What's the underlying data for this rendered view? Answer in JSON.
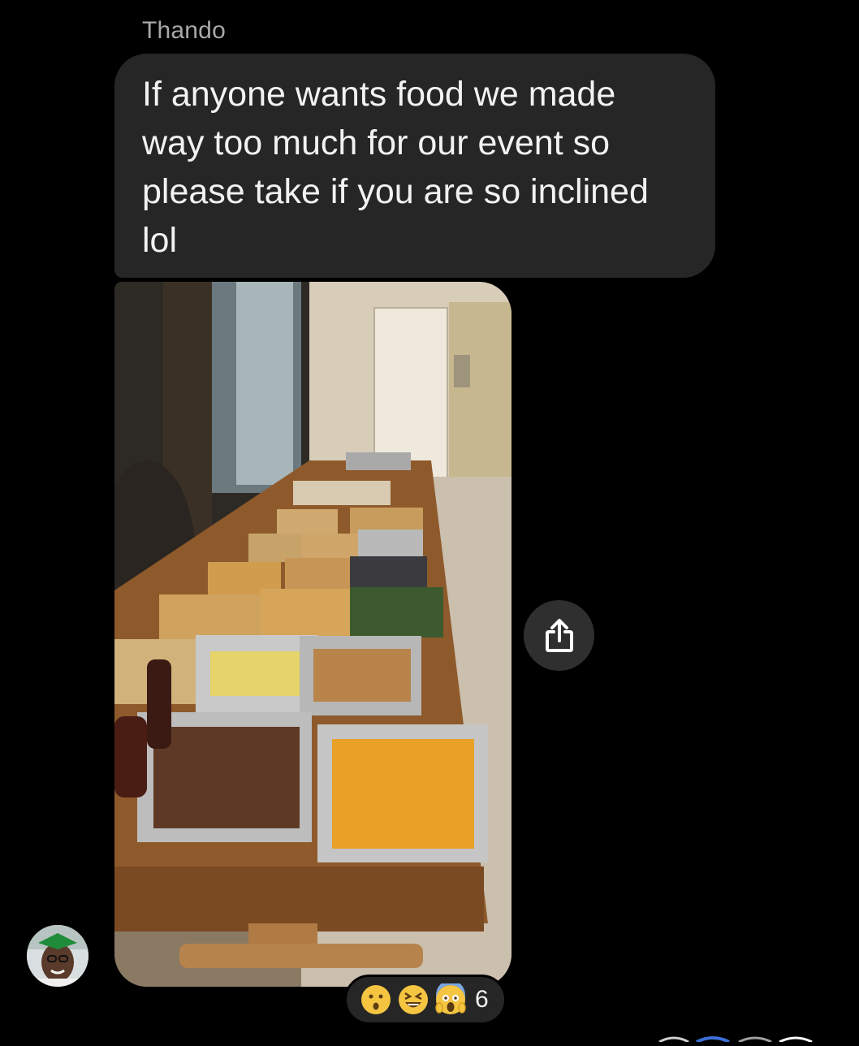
{
  "message": {
    "sender": "Thando",
    "text": "If anyone wants food we made\nway too much for our event so\nplease take if you are so inclined\nlol",
    "photo_alt": "photo-attachment"
  },
  "reactions": {
    "emojis": [
      "hushed-face-icon",
      "grinning-squinting-face-icon",
      "screaming-face-icon"
    ],
    "count": "6"
  },
  "colors": {
    "background": "#000000",
    "bubble": "#262626",
    "sender_name": "#a8a8a8",
    "text": "#f2f2f2",
    "share_button": "#2f2f2f"
  }
}
